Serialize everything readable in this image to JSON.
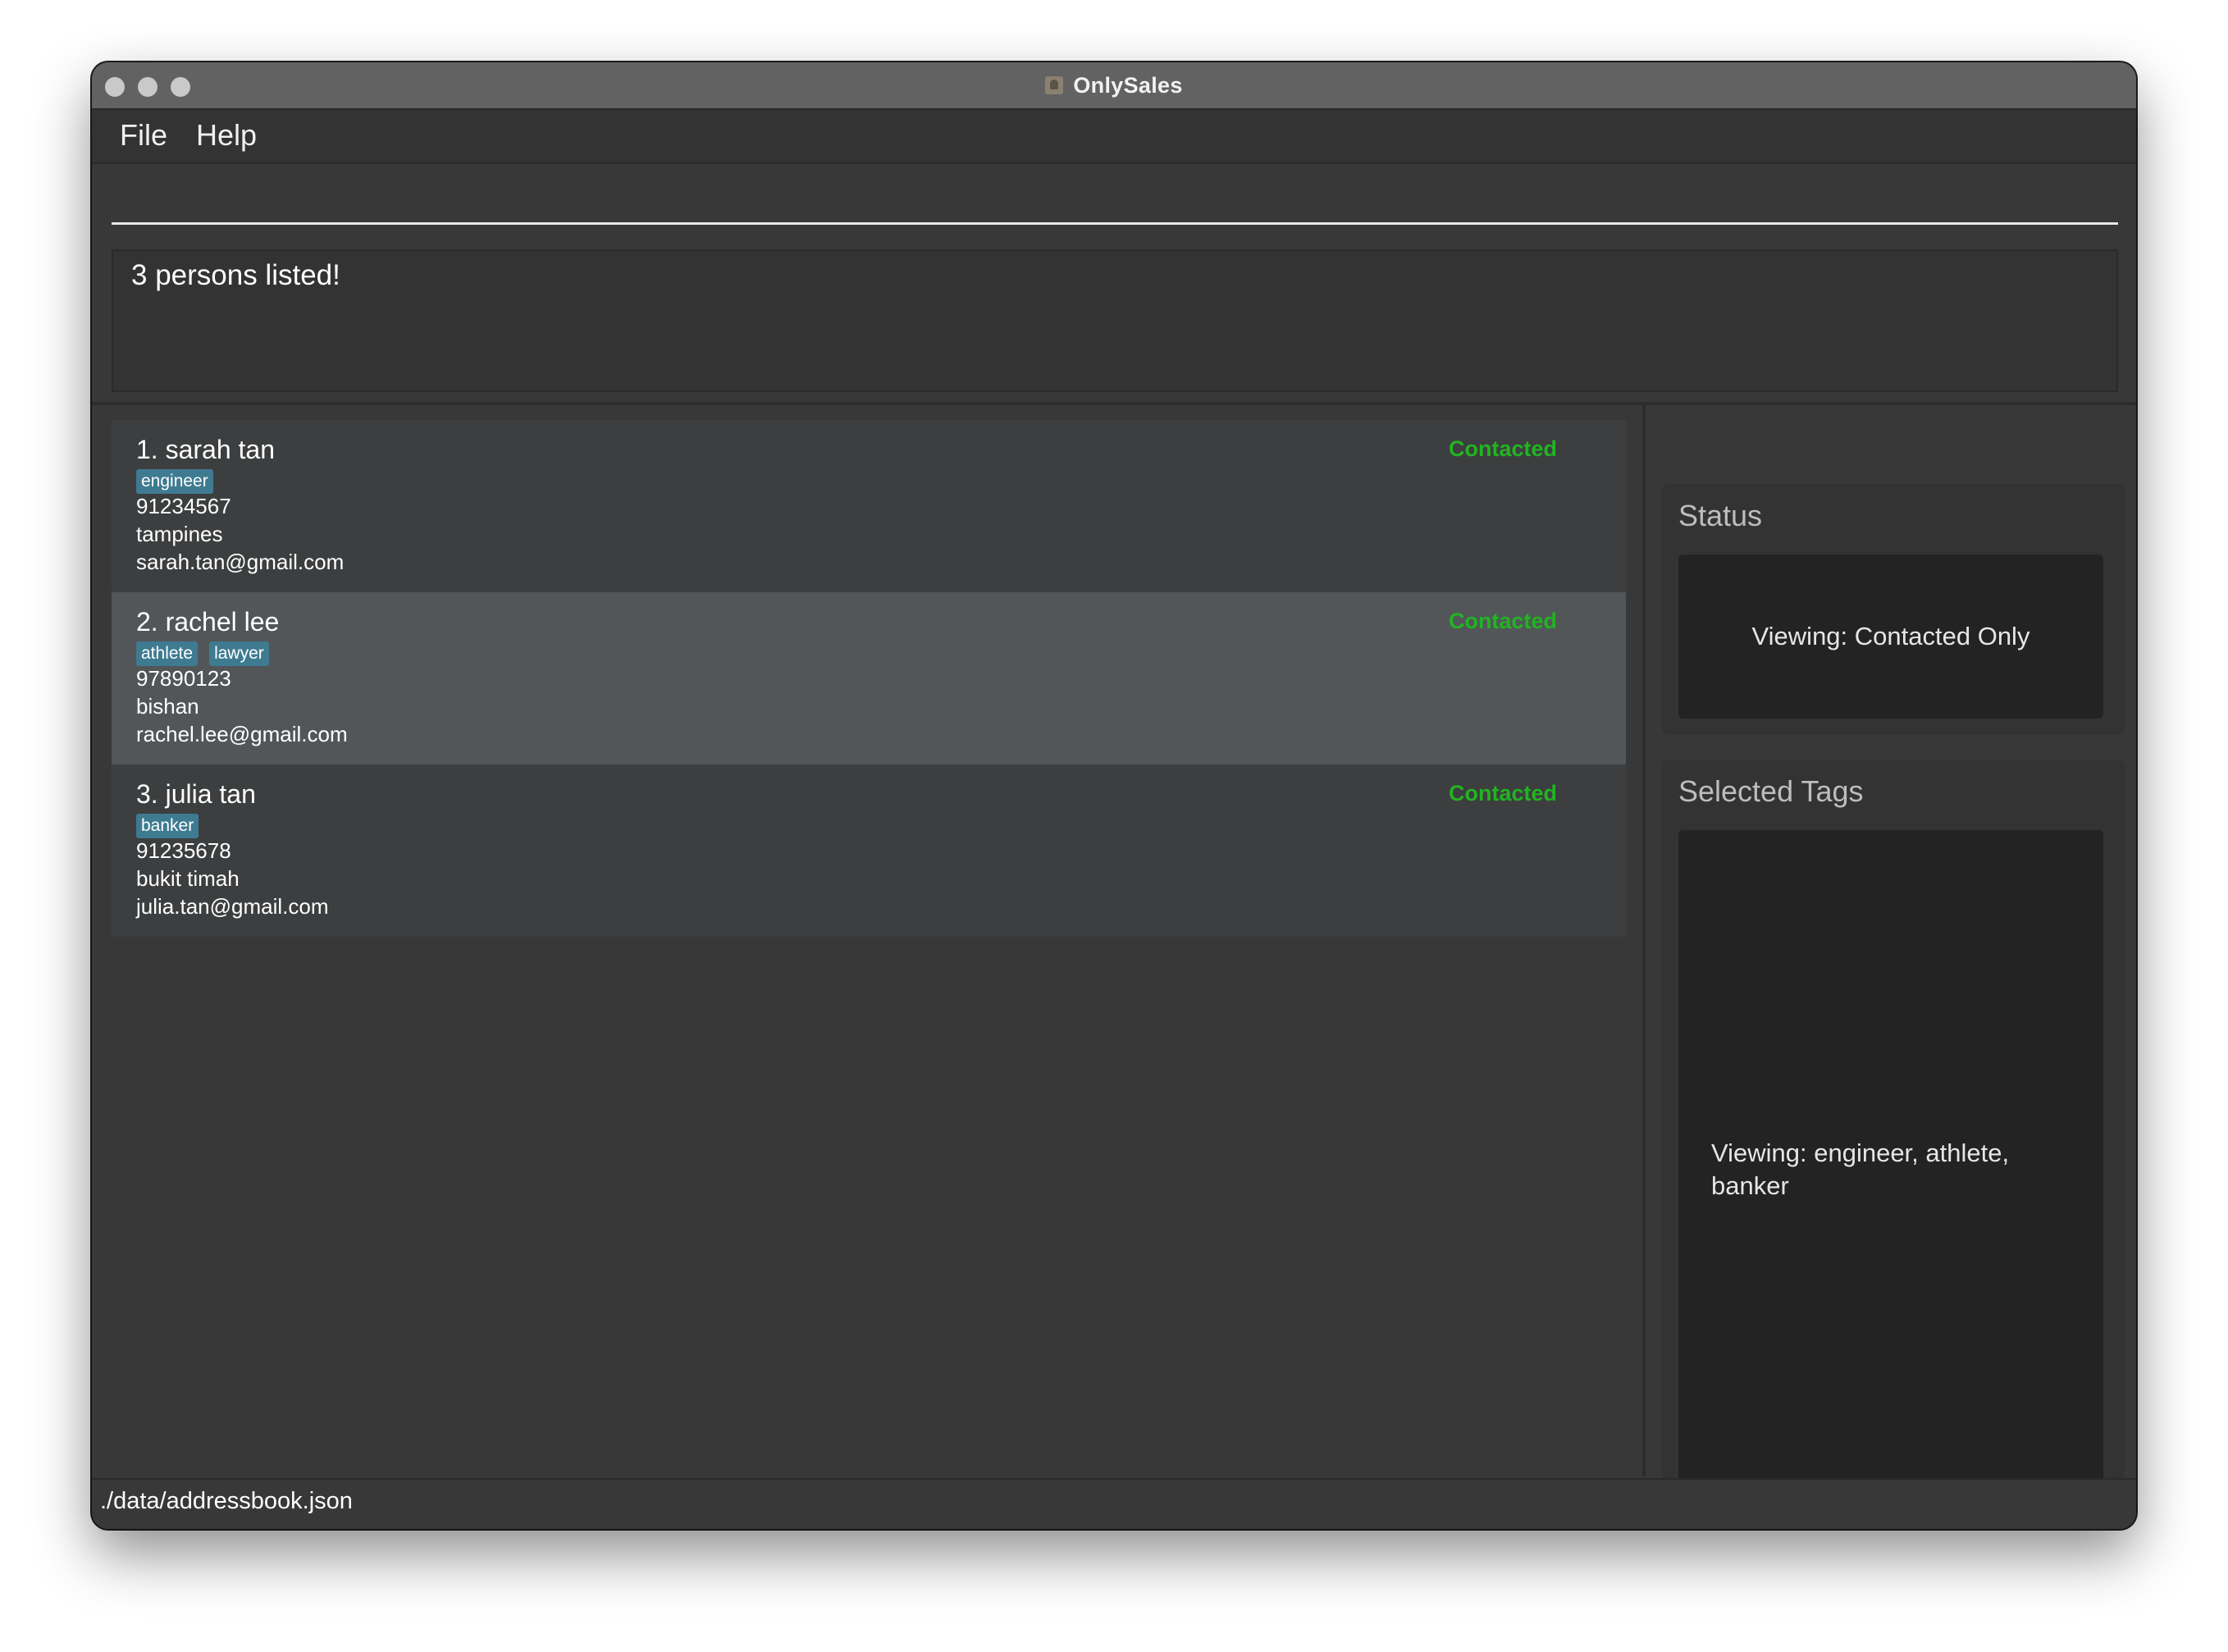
{
  "window": {
    "title": "OnlySales"
  },
  "menu": {
    "file": "File",
    "help": "Help"
  },
  "command": {
    "value": "",
    "placeholder": ""
  },
  "result": {
    "message": "3 persons listed!"
  },
  "persons": [
    {
      "name": "1. sarah tan",
      "status": "Contacted",
      "tags": [
        "engineer"
      ],
      "phone": "91234567",
      "address": "tampines",
      "email": "sarah.tan@gmail.com",
      "selected": false
    },
    {
      "name": "2. rachel lee",
      "status": "Contacted",
      "tags": [
        "athlete",
        "lawyer"
      ],
      "phone": "97890123",
      "address": "bishan",
      "email": "rachel.lee@gmail.com",
      "selected": true
    },
    {
      "name": "3. julia tan",
      "status": "Contacted",
      "tags": [
        "banker"
      ],
      "phone": "91235678",
      "address": "bukit timah",
      "email": "julia.tan@gmail.com",
      "selected": false
    }
  ],
  "status_panel": {
    "title": "Status",
    "text": "Viewing: Contacted Only"
  },
  "tags_panel": {
    "title": "Selected Tags",
    "text": "Viewing: engineer, athlete, banker"
  },
  "footer": {
    "path": "./data/addressbook.json"
  },
  "colors": {
    "background": "#383838",
    "status_green": "#22b322",
    "tag_blue": "#3e7b91",
    "selected_row": "#525659"
  }
}
